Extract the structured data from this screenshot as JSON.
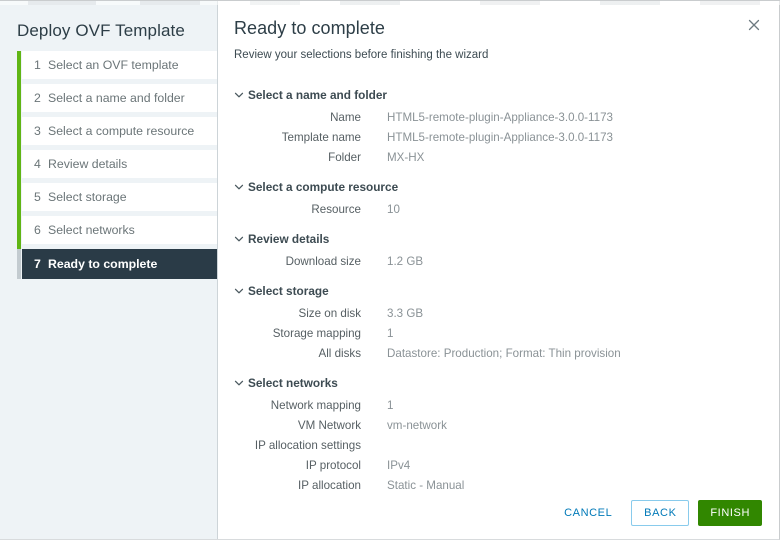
{
  "window": {
    "close_icon": "close-icon"
  },
  "sidebar": {
    "title": "Deploy OVF Template",
    "steps": [
      {
        "num": "1",
        "label": "Select an OVF template",
        "active": false
      },
      {
        "num": "2",
        "label": "Select a name and folder",
        "active": false
      },
      {
        "num": "3",
        "label": "Select a compute resource",
        "active": false
      },
      {
        "num": "4",
        "label": "Review details",
        "active": false
      },
      {
        "num": "5",
        "label": "Select storage",
        "active": false
      },
      {
        "num": "6",
        "label": "Select networks",
        "active": false
      },
      {
        "num": "7",
        "label": "Ready to complete",
        "active": true
      }
    ],
    "progress_color": "#60b515",
    "active_color": "#2a3b47"
  },
  "main": {
    "title": "Ready to complete",
    "subtitle": "Review your selections before finishing the wizard",
    "sections": [
      {
        "label": "Select a name and folder",
        "expanded": true,
        "chevron_icon": "chevron-down-icon",
        "rows": [
          {
            "label": "Name",
            "value": "HTML5-remote-plugin-Appliance-3.0.0-1173",
            "indent": false
          },
          {
            "label": "Template name",
            "value": "HTML5-remote-plugin-Appliance-3.0.0-1173",
            "indent": false
          },
          {
            "label": "Folder",
            "value": "MX-HX",
            "indent": false
          }
        ]
      },
      {
        "label": "Select a compute resource",
        "expanded": true,
        "chevron_icon": "chevron-down-icon",
        "rows": [
          {
            "label": "Resource",
            "value": "10",
            "indent": false
          }
        ]
      },
      {
        "label": "Review details",
        "expanded": true,
        "chevron_icon": "chevron-down-icon",
        "rows": [
          {
            "label": "Download size",
            "value": "1.2 GB",
            "indent": false
          }
        ]
      },
      {
        "label": "Select storage",
        "expanded": true,
        "chevron_icon": "chevron-down-icon",
        "rows": [
          {
            "label": "Size on disk",
            "value": "3.3 GB",
            "indent": false
          },
          {
            "label": "Storage mapping",
            "value": "1",
            "indent": false
          },
          {
            "label": "All disks",
            "value": "Datastore: Production; Format: Thin provision",
            "indent": true
          }
        ]
      },
      {
        "label": "Select networks",
        "expanded": true,
        "chevron_icon": "chevron-down-icon",
        "rows": [
          {
            "label": "Network mapping",
            "value": "1",
            "indent": false
          },
          {
            "label": "VM Network",
            "value": "vm-network",
            "indent": true
          },
          {
            "label": "IP allocation settings",
            "value": "",
            "indent": false
          },
          {
            "label": "IP protocol",
            "value": "IPv4",
            "indent": true
          },
          {
            "label": "IP allocation",
            "value": "Static - Manual",
            "indent": true
          }
        ]
      }
    ]
  },
  "footer": {
    "cancel_label": "CANCEL",
    "back_label": "BACK",
    "finish_label": "FINISH",
    "finish_color": "#318700",
    "link_color": "#0079b8"
  }
}
